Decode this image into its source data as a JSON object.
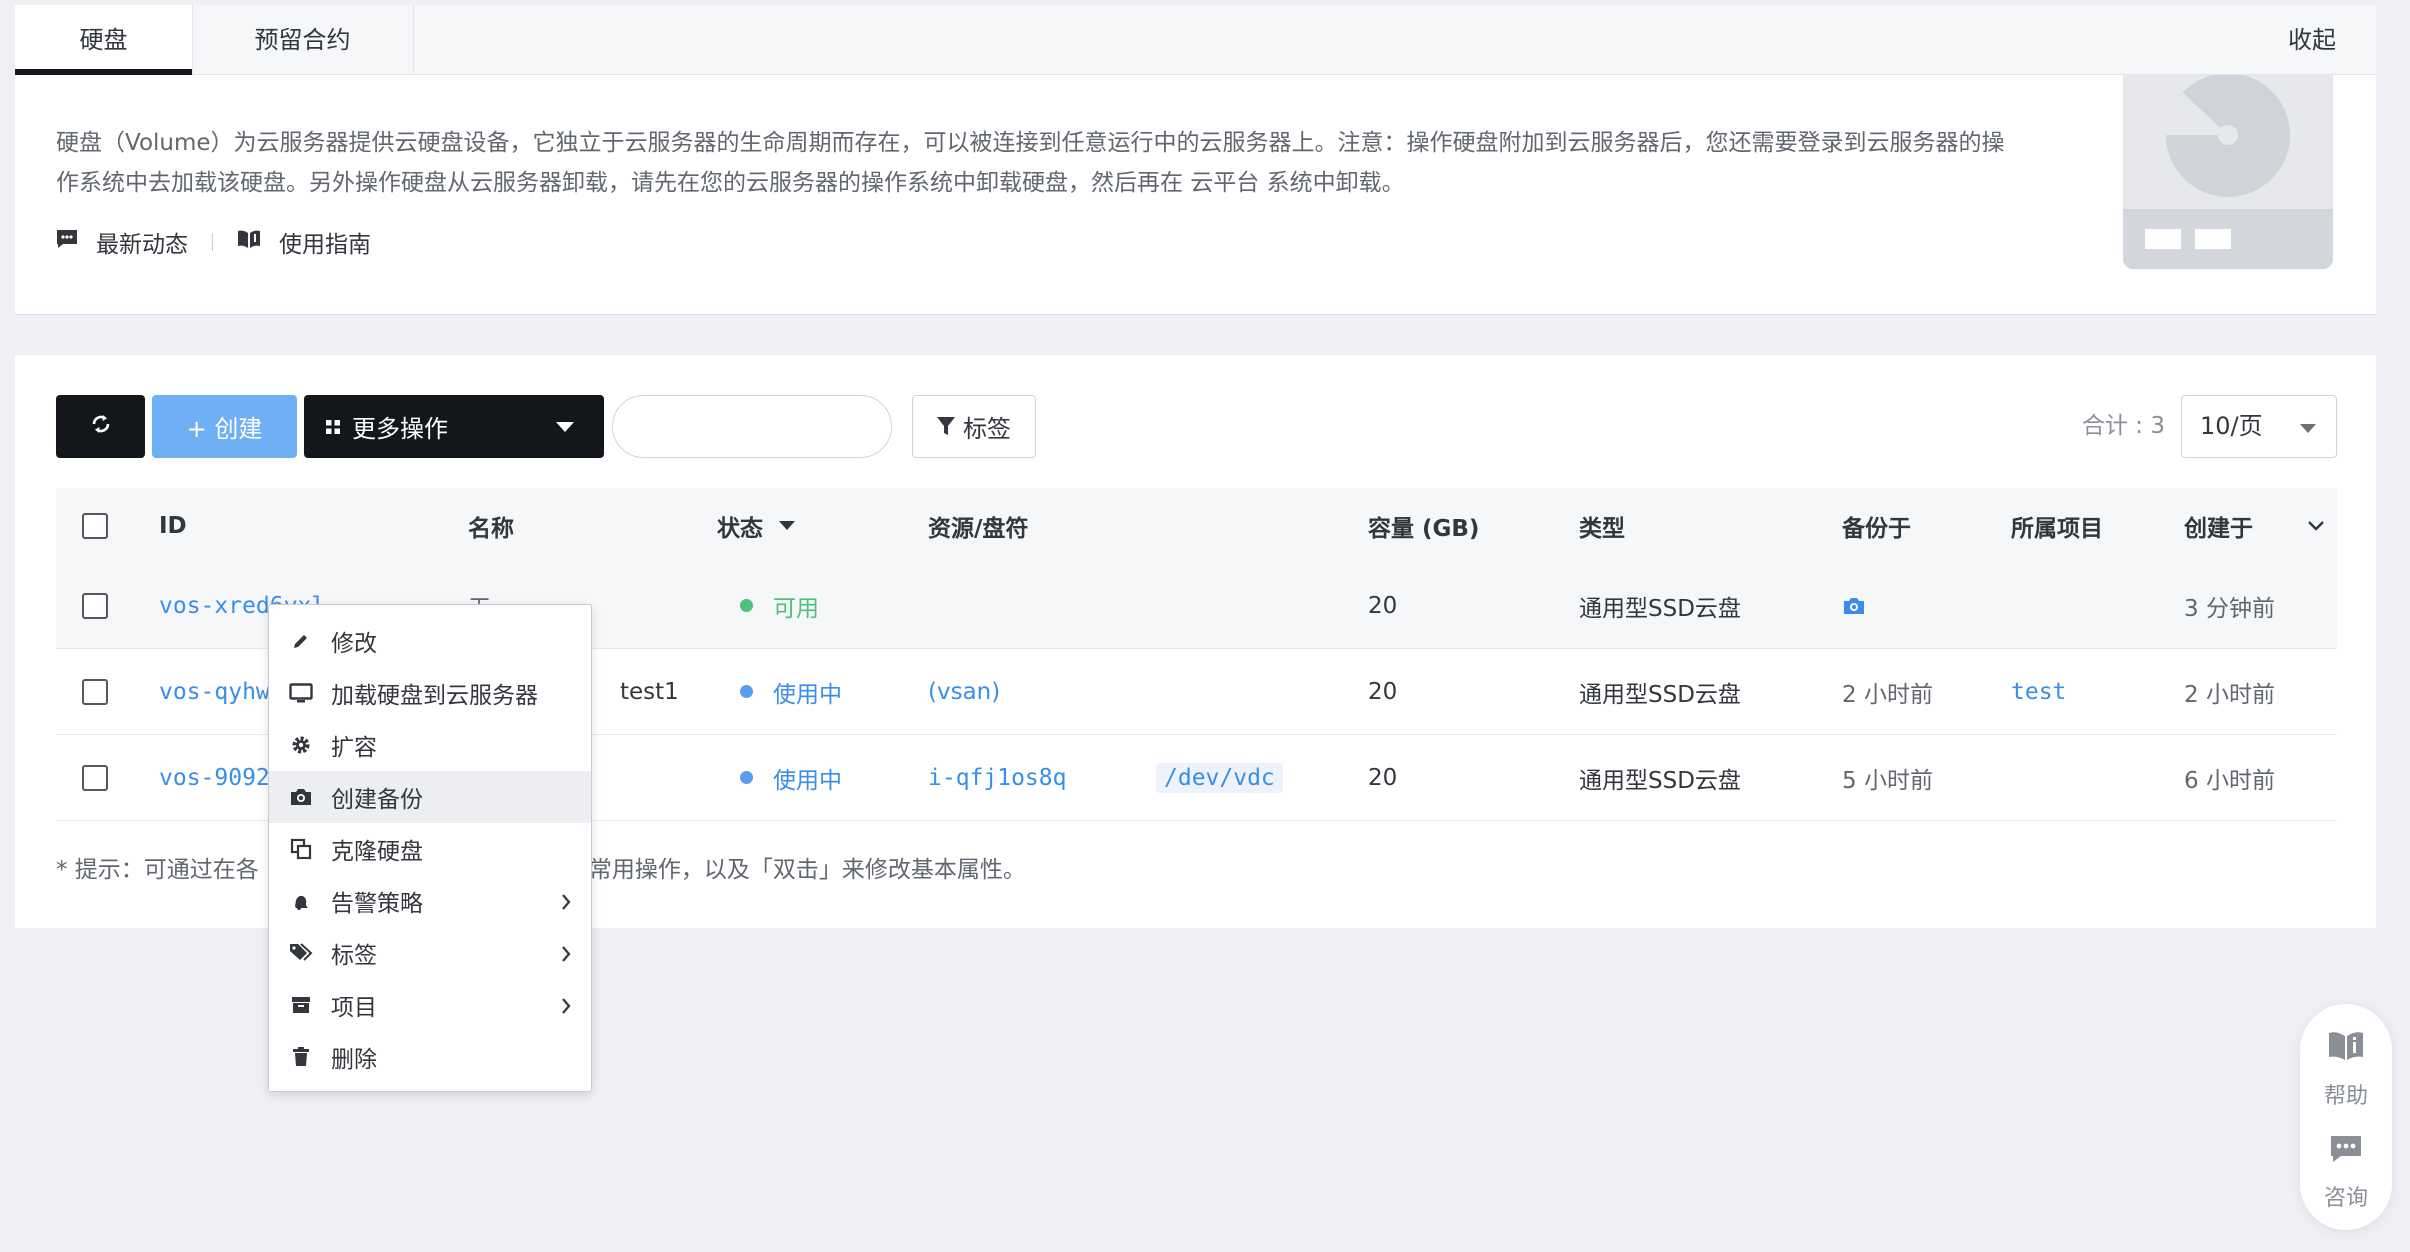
{
  "tabs": [
    {
      "label": "硬盘",
      "active": true
    },
    {
      "label": "预留合约",
      "active": false
    }
  ],
  "collapse_label": "收起",
  "intro": {
    "description": "硬盘（Volume）为云服务器提供云硬盘设备，它独立于云服务器的生命周期而存在，可以被连接到任意运行中的云服务器上。注意：操作硬盘附加到云服务器后，您还需要登录到云服务器的操作系统中去加载该硬盘。另外操作硬盘从云服务器卸载，请先在您的云服务器的操作系统中卸载硬盘，然后再在 云平台 系统中卸载。",
    "news_label": "最新动态",
    "guide_label": "使用指南"
  },
  "toolbar": {
    "create_label": "+ 创建",
    "more_label": "更多操作",
    "search_placeholder": "",
    "tag_label": "标签",
    "total_text": "合计 : 3",
    "page_size": "10/页"
  },
  "columns": {
    "id": "ID",
    "name": "名称",
    "status": "状态",
    "resource": "资源/盘符",
    "capacity": "容量 (GB)",
    "type": "类型",
    "backup": "备份于",
    "project": "所属项目",
    "created": "创建于"
  },
  "rows": [
    {
      "id": "vos-xred6yxl",
      "name": "无",
      "status": "可用",
      "status_color": "#4cc27a",
      "resource": "",
      "device": "",
      "capacity": "20",
      "type": "通用型SSD云盘",
      "backup": "",
      "project": "",
      "created": "3 分钟前"
    },
    {
      "id": "vos-qyhw",
      "name": "test1",
      "status": "使用中",
      "status_color": "#5a9cf0",
      "resource": "(vsan)",
      "device": "",
      "capacity": "20",
      "type": "通用型SSD云盘",
      "backup": "2 小时前",
      "project": "test",
      "created": "2 小时前"
    },
    {
      "id": "vos-9092",
      "name": "",
      "status": "使用中",
      "status_color": "#5a9cf0",
      "resource": "i-qfj1os8q",
      "device": "/dev/vdc",
      "capacity": "20",
      "type": "通用型SSD云盘",
      "backup": "5 小时前",
      "project": "",
      "created": "6 小时前"
    }
  ],
  "tip": {
    "prefix": "* 提示：可通过在各",
    "suffix": "常用操作，以及「双击」来修改基本属性。"
  },
  "context_menu": [
    {
      "label": "修改",
      "icon": "pencil-icon",
      "submenu": false
    },
    {
      "label": "加载硬盘到云服务器",
      "icon": "monitor-icon",
      "submenu": false
    },
    {
      "label": "扩容",
      "icon": "gear-icon",
      "submenu": false
    },
    {
      "label": "创建备份",
      "icon": "camera-icon",
      "submenu": false,
      "highlighted": true
    },
    {
      "label": "克隆硬盘",
      "icon": "clone-icon",
      "submenu": false
    },
    {
      "label": "告警策略",
      "icon": "bell-icon",
      "submenu": true
    },
    {
      "label": "标签",
      "icon": "tags-icon",
      "submenu": true
    },
    {
      "label": "项目",
      "icon": "archive-icon",
      "submenu": true
    },
    {
      "label": "删除",
      "icon": "trash-icon",
      "submenu": false
    }
  ],
  "float_help": {
    "help_label": "帮助",
    "consult_label": "咨询"
  },
  "colors": {
    "primary_dark": "#13161b",
    "create_blue": "#6fb0f5",
    "link_blue": "#3a8ee6",
    "available_green": "#4cc27a"
  }
}
